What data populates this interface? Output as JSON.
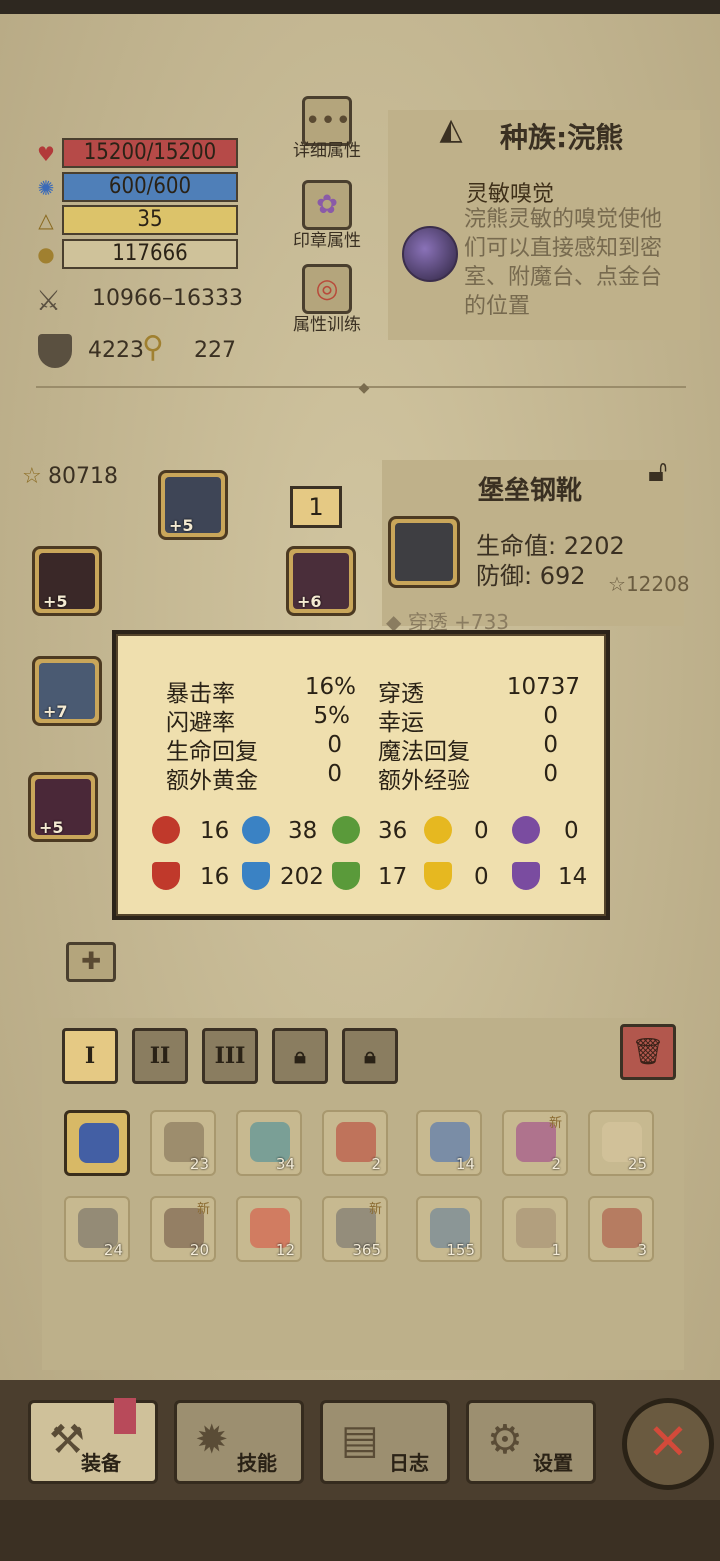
{
  "stats": {
    "hp": "15200/15200",
    "mp": "600/600",
    "level": "35",
    "gold": "117666",
    "attack": "10966",
    "attack_sep": "–",
    "attack_max": "16333",
    "defense": "4223",
    "luck_key": "227",
    "hp_fill": 1.0,
    "mp_fill": 1.0,
    "level_fill": 1.0,
    "gold_fill": 0.0
  },
  "menu": {
    "detail": "详细属性",
    "seal": "印章属性",
    "training": "属性训练"
  },
  "race": {
    "title": "种族:浣熊",
    "trait_name": "灵敏嗅觉",
    "trait_desc": "浣熊灵敏的嗅觉使他们可以直接感知到密室、附魔台、点金台的位置"
  },
  "equipment": {
    "score": "80718",
    "slot_badge": "1",
    "slots": [
      {
        "name": "helmet",
        "level": "+5"
      },
      {
        "name": "cloak",
        "level": "+5"
      },
      {
        "name": "amulet",
        "level": "+6"
      },
      {
        "name": "weapon",
        "level": "+7"
      },
      {
        "name": "armor",
        "level": "+5"
      }
    ]
  },
  "item": {
    "title": "堡垒钢靴",
    "hp_label": "生命值: 2202",
    "def_label": "防御: 692",
    "score": "12208",
    "affix": "◆ 穿透 +733"
  },
  "popup": {
    "rows": [
      {
        "l1": "暴击率",
        "v1": "16%",
        "l2": "穿透",
        "v2": "10737"
      },
      {
        "l1": "闪避率",
        "v1": "5%",
        "l2": "幸运",
        "v2": "0"
      },
      {
        "l1": "生命回复",
        "v1": "0",
        "l2": "魔法回复",
        "v2": "0"
      },
      {
        "l1": "额外黄金",
        "v1": "0",
        "l2": "额外经验",
        "v2": "0"
      }
    ],
    "atk": [
      "16",
      "38",
      "36",
      "0",
      "0"
    ],
    "res": [
      "16",
      "202",
      "17",
      "0",
      "14"
    ],
    "colors": {
      "fire": "#c0392b",
      "water": "#3a82c4",
      "wind": "#5a9a3a",
      "light": "#e6b820",
      "dark": "#7a4ca0"
    }
  },
  "tabs": [
    "I",
    "II",
    "III"
  ],
  "inventory": {
    "row1": [
      {
        "name": "equipped-helmet",
        "count": "",
        "new": "",
        "color": "#3b5aa8"
      },
      {
        "name": "pickaxe",
        "count": "23",
        "new": "",
        "color": "#7a6a50"
      },
      {
        "name": "eye-scroll",
        "count": "34",
        "new": "",
        "color": "#3a8a9a"
      },
      {
        "name": "red-potion",
        "count": "2",
        "new": "",
        "color": "#b83a30"
      },
      {
        "name": "blue-potion",
        "count": "14",
        "new": "",
        "color": "#3a6ab8"
      },
      {
        "name": "purple-potion",
        "count": "2",
        "new": "新",
        "color": "#9a3a8a"
      },
      {
        "name": "scroll",
        "count": "25",
        "new": "",
        "color": "#d8c9a0"
      }
    ],
    "row2": [
      {
        "name": "stone-block",
        "count": "24",
        "new": "",
        "color": "#6a6660"
      },
      {
        "name": "chest",
        "count": "20",
        "new": "新",
        "color": "#6a5040"
      },
      {
        "name": "bowl",
        "count": "12",
        "new": "",
        "color": "#d84a3a"
      },
      {
        "name": "iron-ingot",
        "count": "365",
        "new": "新",
        "color": "#6a6a6a"
      },
      {
        "name": "crystal",
        "count": "155",
        "new": "",
        "color": "#5a7a9a"
      },
      {
        "name": "heart-ring",
        "count": "1",
        "new": "",
        "color": "#a08a70"
      },
      {
        "name": "red-book",
        "count": "3",
        "new": "",
        "color": "#a84a3a"
      }
    ]
  },
  "nav": {
    "equip": "装备",
    "skill": "技能",
    "log": "日志",
    "settings": "设置"
  }
}
